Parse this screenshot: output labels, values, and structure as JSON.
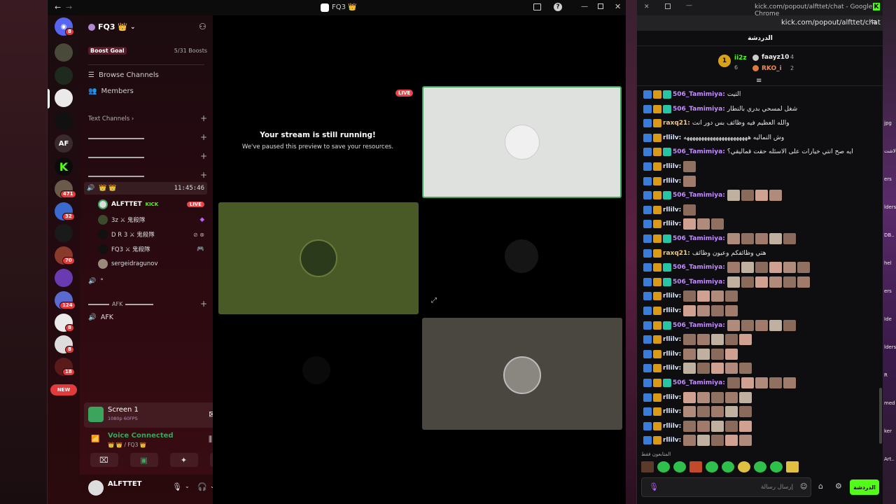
{
  "discord": {
    "window_title": "FQ3 👑",
    "server": {
      "name": "FQ3 👑",
      "boost_goal_label": "Boost Goal",
      "boost_count": "5/31 Boosts"
    },
    "nav": {
      "browse_channels": "Browse Channels",
      "members": "Members"
    },
    "text_channels_label": "Text Channels",
    "voice_channel": {
      "name": "👑 👑",
      "timer": "11:45:46"
    },
    "voice_users": [
      {
        "name": "ALFTTET",
        "tag": "KICK",
        "live": "LIVE"
      },
      {
        "name": "3z ⚔ 鬼殺隊"
      },
      {
        "name": "D R 3 ⚔ 鬼殺隊"
      },
      {
        "name": "FQ3 ⚔ 鬼殺隊"
      },
      {
        "name": "sergeidragunov"
      }
    ],
    "voice_channel2": "°",
    "afk_header": "AFK",
    "afk_channel": "AFK",
    "guild_badges": [
      "8",
      "471",
      "32",
      "70",
      "124",
      "8",
      "8",
      "18"
    ],
    "guild_af_label": "AF",
    "new_label": "NEW",
    "screen_share": {
      "title": "Screen 1",
      "quality": "1080p 60FPS"
    },
    "voice_connected": {
      "label": "Voice Connected",
      "channel": "👑 👑 / FQ3 👑"
    },
    "user": {
      "name": "ALFTTET"
    },
    "stream": {
      "live": "LIVE",
      "title": "Your stream is still running!",
      "sub": "We've paused this preview to save your resources."
    }
  },
  "kick": {
    "window_title": "kick.com/popout/alfttet/chat - Google Chrome",
    "url": "kick.com/popout/alfttet/chat",
    "header": "الدردشة",
    "leaderboard": {
      "first": "ii2z",
      "first_count": "6",
      "second": "faayz10",
      "second_count": "4",
      "third": "RKO_i",
      "third_count": "2",
      "rank": "1"
    },
    "messages": [
      {
        "user": "506_Tamimiya",
        "color": "#c38cff",
        "text": "التيت",
        "emotes": 0,
        "b3": true
      },
      {
        "user": "506_Tamimiya",
        "color": "#c38cff",
        "text": "شغل لمسحي بدري بالنطار",
        "emotes": 0,
        "b3": true
      },
      {
        "user": "raxq21",
        "color": "#f0c97a",
        "text": "والله العظيم فيه وظائف بس دور انت",
        "emotes": 0,
        "b3": false
      },
      {
        "user": "rllilv",
        "color": "#dbe7ff",
        "text": "وش النماليه ههههههههههههههههههههههه",
        "emotes": 0,
        "b3": false
      },
      {
        "user": "506_Tamimiya",
        "color": "#c38cff",
        "text": "ايه صح انتي خيارات على الاسئله حقت قماليقي؟",
        "emotes": 0,
        "b3": true
      },
      {
        "user": "rllilv",
        "color": "#dbe7ff",
        "text": "",
        "emotes": 1,
        "b3": false
      },
      {
        "user": "rllilv",
        "color": "#dbe7ff",
        "text": "",
        "emotes": 1,
        "b3": false
      },
      {
        "user": "506_Tamimiya",
        "color": "#c38cff",
        "text": "",
        "emotes": 4,
        "b3": true
      },
      {
        "user": "rllilv",
        "color": "#dbe7ff",
        "text": "",
        "emotes": 1,
        "b3": false
      },
      {
        "user": "rllilv",
        "color": "#dbe7ff",
        "text": "",
        "emotes": 3,
        "b3": false
      },
      {
        "user": "506_Tamimiya",
        "color": "#c38cff",
        "text": "",
        "emotes": 5,
        "b3": true
      },
      {
        "user": "raxq21",
        "color": "#f0c97a",
        "text": "هتي وظائفكم وعيون وظائف",
        "emotes": 0,
        "b3": false
      },
      {
        "user": "506_Tamimiya",
        "color": "#c38cff",
        "text": "",
        "emotes": 6,
        "b3": true
      },
      {
        "user": "506_Tamimiya",
        "color": "#c38cff",
        "text": "",
        "emotes": 6,
        "b3": true
      },
      {
        "user": "rllilv",
        "color": "#dbe7ff",
        "text": "",
        "emotes": 4,
        "b3": false
      },
      {
        "user": "rllilv",
        "color": "#dbe7ff",
        "text": "",
        "emotes": 4,
        "b3": false
      },
      {
        "user": "506_Tamimiya",
        "color": "#c38cff",
        "text": "",
        "emotes": 5,
        "b3": true
      },
      {
        "user": "rllilv",
        "color": "#dbe7ff",
        "text": "",
        "emotes": 5,
        "b3": false
      },
      {
        "user": "rllilv",
        "color": "#dbe7ff",
        "text": "",
        "emotes": 4,
        "b3": false
      },
      {
        "user": "rllilv",
        "color": "#dbe7ff",
        "text": "",
        "emotes": 5,
        "b3": false
      },
      {
        "user": "506_Tamimiya",
        "color": "#c38cff",
        "text": "",
        "emotes": 5,
        "b3": true
      },
      {
        "user": "rllilv",
        "color": "#dbe7ff",
        "text": "",
        "emotes": 5,
        "b3": false
      },
      {
        "user": "rllilv",
        "color": "#dbe7ff",
        "text": "",
        "emotes": 5,
        "b3": false
      },
      {
        "user": "rllilv",
        "color": "#dbe7ff",
        "text": "",
        "emotes": 5,
        "b3": false
      },
      {
        "user": "rllilv",
        "color": "#dbe7ff",
        "text": "",
        "emotes": 5,
        "b3": false
      }
    ],
    "emote_bar_label": "المتابعون فقط",
    "input_placeholder": "إرسال رسالة",
    "send_label": "الدردشة",
    "accent": "#53fc18"
  },
  "side": {
    "right_labels": [
      "jpg",
      "الاشت",
      "ers",
      "lders",
      "DB..",
      "hel",
      "ers",
      "Ide",
      "lders",
      "R",
      "med",
      "ker",
      "Art.."
    ]
  }
}
